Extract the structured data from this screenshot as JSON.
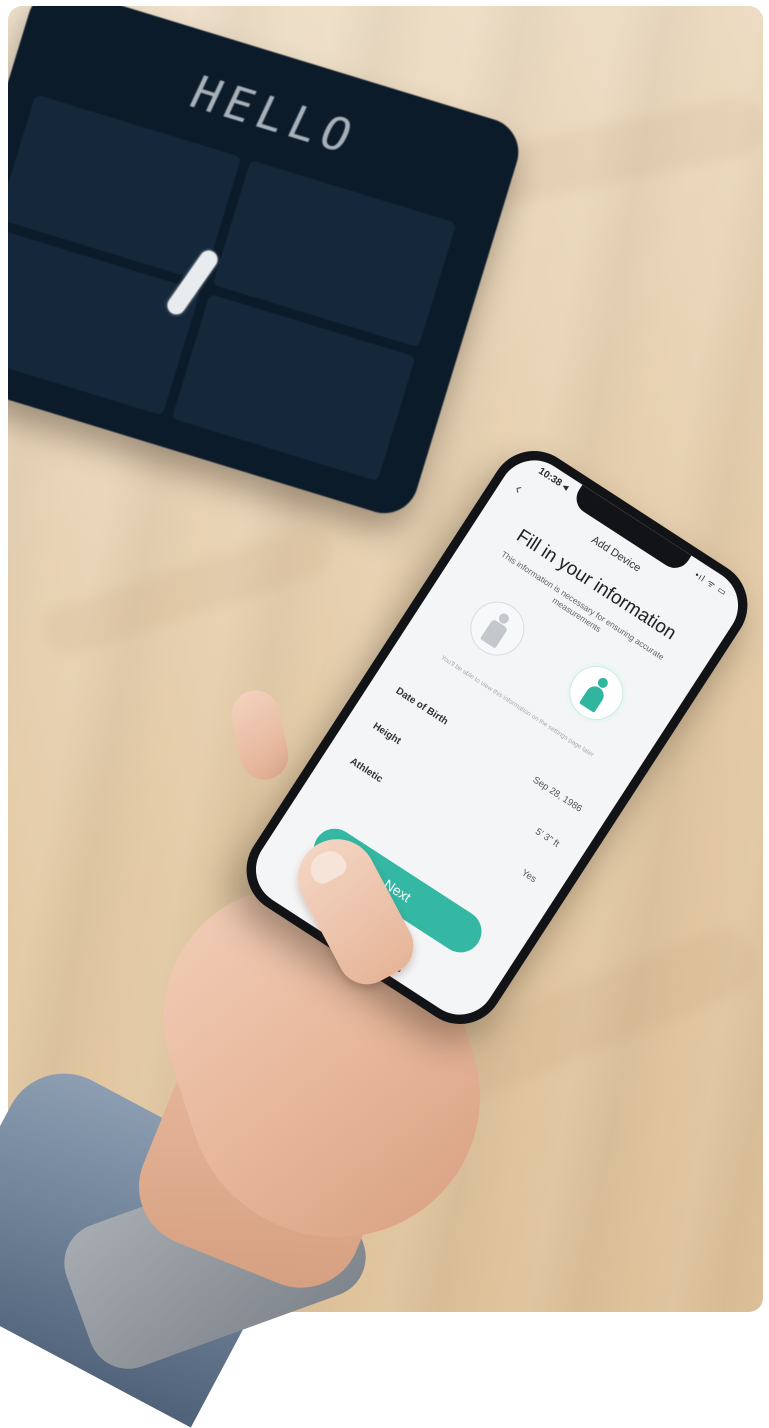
{
  "scale": {
    "display_text": "HELLO",
    "color": "#0c1b2a"
  },
  "phone_screen": {
    "status_time": "10:38 ◂",
    "status_icons": "•ıl ᯤ ▭",
    "nav_title": "Add Device",
    "back_icon": "‹",
    "title": "Fill in your information",
    "subtitle": "This information is necessary for ensuring accurate measurements",
    "gender_options": [
      {
        "icon": "male-figure-icon",
        "selected": false
      },
      {
        "icon": "female-figure-icon",
        "selected": true
      }
    ],
    "hint": "You'll be able to view this information on the settings page later",
    "fields": [
      {
        "label": "Date of Birth",
        "value": "Sep 28, 1986"
      },
      {
        "label": "Height",
        "value": "5' 3\" ft"
      },
      {
        "label": "Athletic",
        "value": "Yes"
      }
    ],
    "next_button": "Next",
    "accent_color": "#34b8a4"
  }
}
